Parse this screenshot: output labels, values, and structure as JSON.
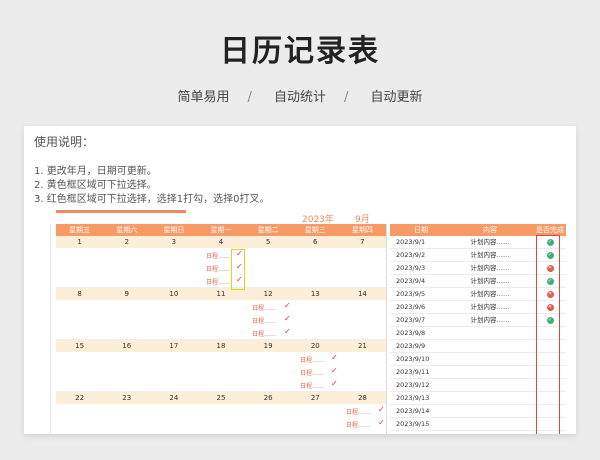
{
  "hero": {
    "title": "日历记录表",
    "features": [
      "简单易用",
      "自动统计",
      "自动更新"
    ],
    "separator": "/"
  },
  "instructions": {
    "title": "使用说明：",
    "lines": [
      "1. 更改年月，日期可更新。",
      "2. 黄色框区域可下拉选择。",
      "3. 红色框区域可下拉选择，选择1打勾，选择0打叉。"
    ]
  },
  "calendar": {
    "year": "2023年",
    "month": "9月",
    "weekdays": [
      "星期五",
      "星期六",
      "星期日",
      "星期一",
      "星期二",
      "星期三",
      "星期四"
    ],
    "weeks": [
      [
        "1",
        "2",
        "3",
        "4",
        "5",
        "6",
        "7"
      ],
      [
        "8",
        "9",
        "10",
        "11",
        "12",
        "13",
        "14"
      ],
      [
        "15",
        "16",
        "17",
        "18",
        "19",
        "20",
        "21"
      ],
      [
        "22",
        "23",
        "24",
        "25",
        "26",
        "27",
        "28"
      ]
    ],
    "entry_label": "日程……",
    "tick": "✓"
  },
  "plan_table": {
    "headers": [
      "日期",
      "内容",
      "是否完成"
    ],
    "rows": [
      {
        "date": "2023/9/1",
        "content": "计划内容……",
        "status": "ok"
      },
      {
        "date": "2023/9/2",
        "content": "计划内容……",
        "status": "ok"
      },
      {
        "date": "2023/9/3",
        "content": "计划内容……",
        "status": "no"
      },
      {
        "date": "2023/9/4",
        "content": "计划内容……",
        "status": "ok"
      },
      {
        "date": "2023/9/5",
        "content": "计划内容……",
        "status": "no"
      },
      {
        "date": "2023/9/6",
        "content": "计划内容……",
        "status": "no"
      },
      {
        "date": "2023/9/7",
        "content": "计划内容……",
        "status": "ok"
      },
      {
        "date": "2023/9/8",
        "content": "",
        "status": ""
      },
      {
        "date": "2023/9/9",
        "content": "",
        "status": ""
      },
      {
        "date": "2023/9/10",
        "content": "",
        "status": ""
      },
      {
        "date": "2023/9/11",
        "content": "",
        "status": ""
      },
      {
        "date": "2023/9/12",
        "content": "",
        "status": ""
      },
      {
        "date": "2023/9/13",
        "content": "",
        "status": ""
      },
      {
        "date": "2023/9/14",
        "content": "",
        "status": ""
      },
      {
        "date": "2023/9/15",
        "content": "",
        "status": ""
      }
    ],
    "ok_glyph": "✓",
    "no_glyph": "✕"
  },
  "colors": {
    "accent": "#f79a66",
    "date_row_bg": "#fdeed9",
    "entry_text": "#e0624a",
    "ok": "#3bb273",
    "no": "#e05a4e",
    "yellow_frame": "#e8d21a",
    "red_frame": "#d84a3c"
  }
}
